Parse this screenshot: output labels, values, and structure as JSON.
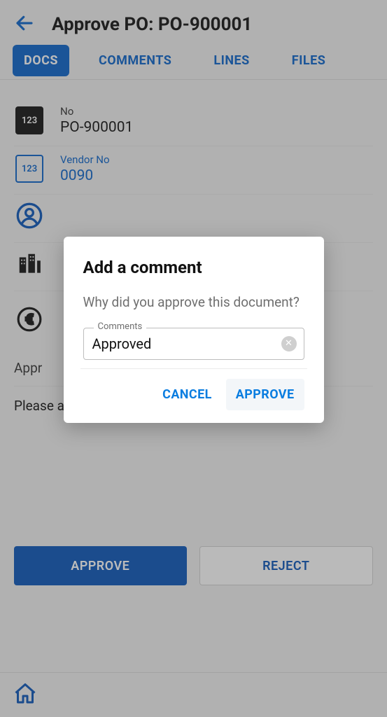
{
  "header": {
    "title": "Approve PO: PO-900001"
  },
  "tabs": {
    "docs": "DOCS",
    "comments": "COMMENTS",
    "lines": "LINES",
    "files": "FILES",
    "active": "docs"
  },
  "fields": {
    "no": {
      "label": "No",
      "value": "PO-900001",
      "icon_text": "123"
    },
    "vendor_no": {
      "label": "Vendor No",
      "value": "0090",
      "icon_text": "123"
    }
  },
  "section_label_truncated": "Appr",
  "note": "Please approve this purchase order ASAP",
  "buttons": {
    "approve": "APPROVE",
    "reject": "REJECT"
  },
  "dialog": {
    "title": "Add a comment",
    "prompt": "Why did you approve this document?",
    "field_label": "Comments",
    "field_value": "Approved",
    "cancel": "CANCEL",
    "approve": "APPROVE"
  }
}
